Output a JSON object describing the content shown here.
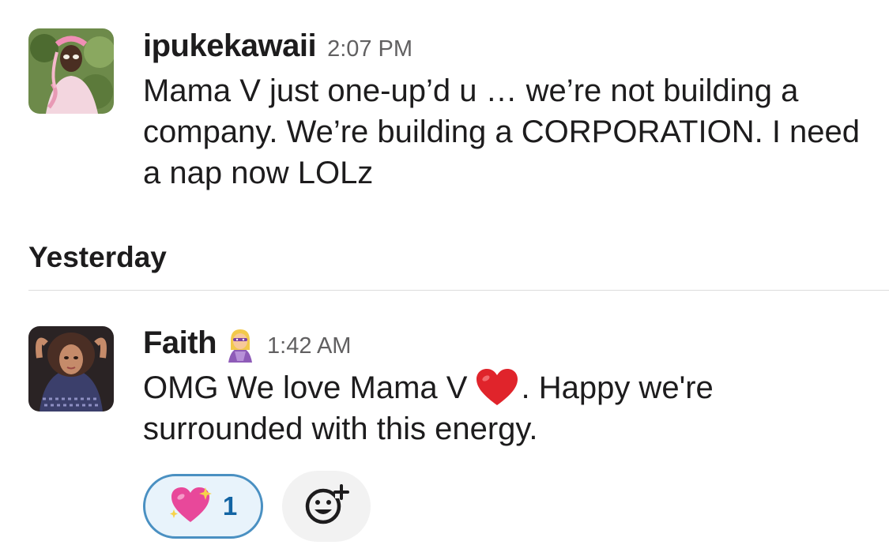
{
  "messages": [
    {
      "author": "ipukekawaii",
      "time": "2:07 PM",
      "text": "Mama V just one-up’d u … we’re not building a company. We’re building a CORPORATION. I need a nap now LOLz",
      "avatar_icon": "user-avatar-photo"
    },
    {
      "author": "Faith",
      "status_icon": "superhero-woman-emoji",
      "time": "1:42 AM",
      "text_before_emoji": "OMG  We love Mama V",
      "inline_icon": "red-heart-emoji",
      "text_after_emoji": ". Happy we're surrounded with this energy.",
      "avatar_icon": "user-avatar-photo",
      "reactions": [
        {
          "icon": "sparkling-heart-emoji",
          "count": "1"
        }
      ],
      "add_reaction_icon": "add-reaction-icon"
    }
  ],
  "divider": {
    "label": "Yesterday"
  },
  "colors": {
    "text": "#1d1c1d",
    "timestamp": "#616061",
    "reaction_border": "#4a90c2",
    "reaction_bg": "#e8f3fb",
    "reaction_count": "#1264a3",
    "divider": "#dddddd"
  }
}
